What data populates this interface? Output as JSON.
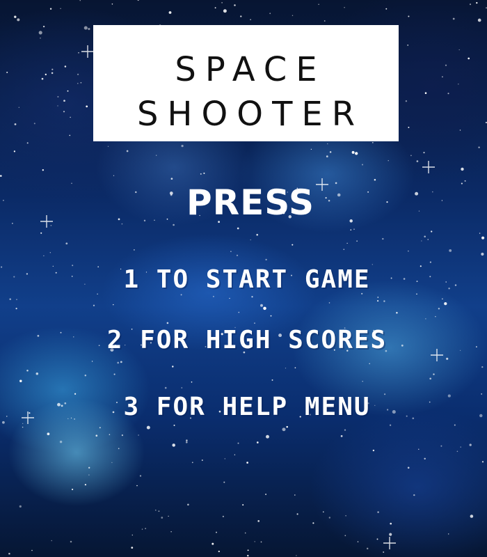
{
  "title": {
    "line1": "SPACE",
    "line2": "SHOOTER"
  },
  "prompt": "PRESS",
  "menu": {
    "start": "1 TO START GAME",
    "scores": "2 FOR HIGH SCORES",
    "help": "3 FOR HELP MENU"
  },
  "colors": {
    "text": "#ffffff",
    "title_box": "#ffffff",
    "title_text": "#111111",
    "space_dark": "#071532",
    "nebula_blue": "#113f8a",
    "nebula_cyan": "#78dcff"
  }
}
